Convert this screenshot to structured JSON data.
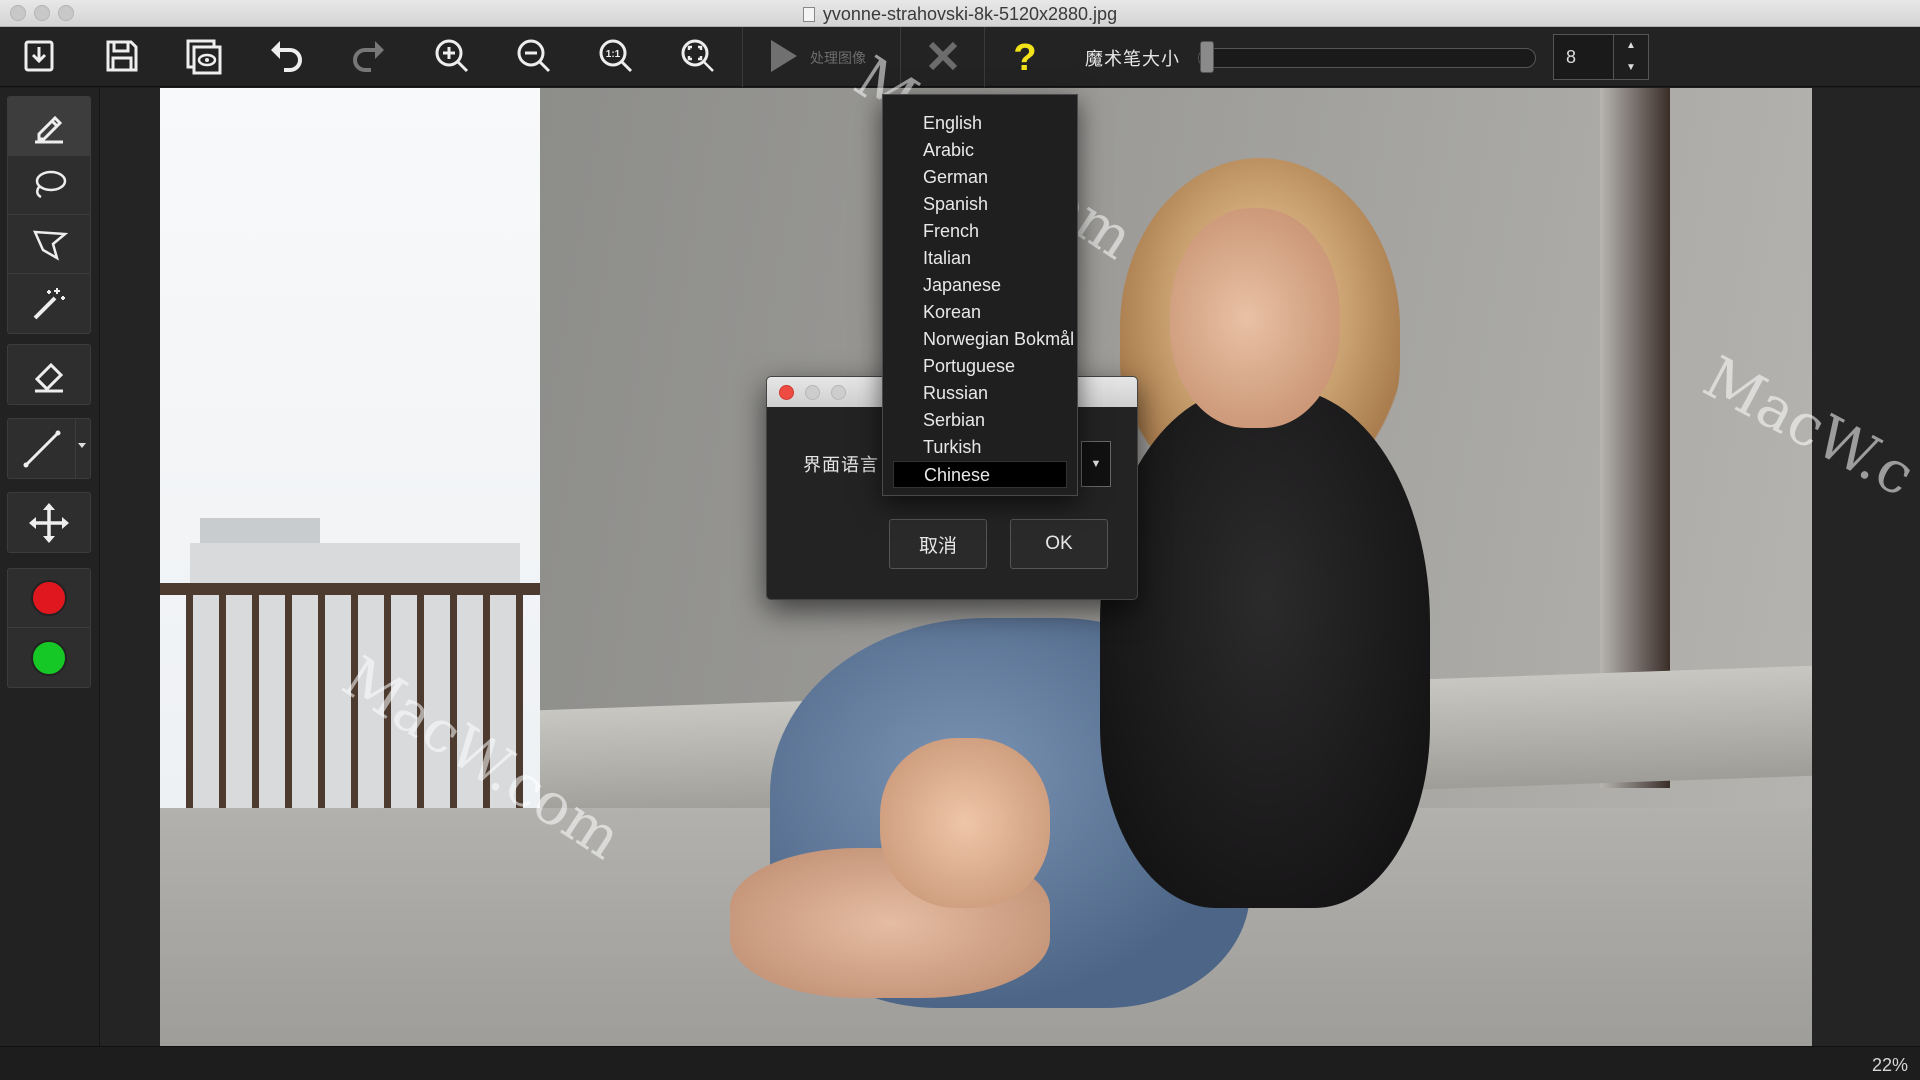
{
  "window": {
    "title": "yvonne-strahovski-8k-5120x2880.jpg"
  },
  "toolbar": {
    "process_label": "处理图像",
    "brush_size_label": "魔术笔大小",
    "brush_size_value": "8",
    "brush_size_level": 0.0,
    "stepper_up": "▲",
    "stepper_down": "▼",
    "icons": [
      "open-file-icon",
      "save-icon",
      "preview-icon",
      "undo-icon",
      "redo-icon",
      "zoom-in-icon",
      "zoom-out-icon",
      "actual-size-icon",
      "fit-screen-icon",
      "play-icon",
      "close-x-icon",
      "help-icon"
    ]
  },
  "tools": [
    "brush-icon",
    "lasso-icon",
    "polygon-lasso-icon",
    "magic-wand-icon",
    "eraser-icon",
    "line-icon",
    "move-icon"
  ],
  "colors": {
    "foreground": "#e0171f",
    "background": "#16c825",
    "help_accent": "#f2e21a"
  },
  "watermarks": [
    "MacW.com",
    "MacW.com",
    "MacW.c"
  ],
  "status": {
    "zoom": "22%"
  },
  "dialog": {
    "label": "界面语言",
    "dropdown_arrow": "▼",
    "cancel_label": "取消",
    "ok_label": "OK"
  },
  "languages": {
    "items": [
      "English",
      "Arabic",
      "German",
      "Spanish",
      "French",
      "Italian",
      "Japanese",
      "Korean",
      "Norwegian Bokmål",
      "Portuguese",
      "Russian",
      "Serbian",
      "Turkish",
      "Chinese"
    ],
    "selected": "Chinese"
  }
}
